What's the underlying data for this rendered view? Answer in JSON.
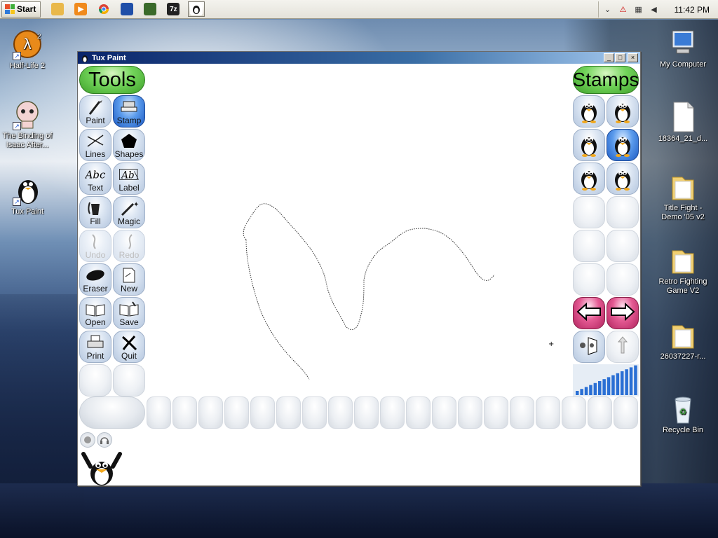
{
  "taskbar": {
    "start_label": "Start",
    "quick_launch": [
      {
        "icon": "folder-icon",
        "color": "#e9b84a",
        "glyph": ""
      },
      {
        "icon": "media-player-icon",
        "color": "#f08a1c",
        "glyph": "▶"
      },
      {
        "icon": "chrome-icon",
        "color": "#3d8ee8",
        "glyph": ""
      },
      {
        "icon": "app-blue-icon",
        "color": "#1f4fa8",
        "glyph": ""
      },
      {
        "icon": "globe-icon",
        "color": "#3a6a2a",
        "glyph": ""
      },
      {
        "icon": "7zip-icon",
        "color": "#222222",
        "glyph": "7z"
      },
      {
        "icon": "tux-paint-taskbar-icon",
        "color": "#ffffff",
        "glyph": ""
      }
    ],
    "clock": "11:42 PM"
  },
  "desktop": {
    "icons_left": [
      {
        "label": "Half-Life 2",
        "icon": "half-life-2-icon"
      },
      {
        "label": "The Binding of Isaac After...",
        "icon": "binding-of-isaac-icon"
      },
      {
        "label": "Tux Paint",
        "icon": "tux-paint-icon"
      }
    ],
    "icons_right": [
      {
        "label": "My Computer",
        "icon": "my-computer-icon"
      },
      {
        "label": "18364_21_d...",
        "icon": "file-icon"
      },
      {
        "label": "Title Fight - Demo '05 v2",
        "icon": "folder-icon"
      },
      {
        "label": "Retro Fighting Game V2",
        "icon": "folder-icon"
      },
      {
        "label": "26037227-r...",
        "icon": "folder-icon"
      },
      {
        "label": "Recycle Bin",
        "icon": "recycle-bin-icon"
      }
    ]
  },
  "window": {
    "title": "Tux Paint",
    "controls": {
      "minimize": "_",
      "maximize": "□",
      "close": "×"
    }
  },
  "tools": {
    "header": "Tools",
    "items": [
      {
        "label": "Paint",
        "icon": "paintbrush-icon",
        "state": "normal"
      },
      {
        "label": "Stamp",
        "icon": "stamp-icon",
        "state": "selected"
      },
      {
        "label": "Lines",
        "icon": "lines-icon",
        "state": "normal"
      },
      {
        "label": "Shapes",
        "icon": "pentagon-icon",
        "state": "normal"
      },
      {
        "label": "Text",
        "icon": "text-abc-icon",
        "state": "normal"
      },
      {
        "label": "Label",
        "icon": "label-abc-icon",
        "state": "normal"
      },
      {
        "label": "Fill",
        "icon": "paint-bucket-icon",
        "state": "normal"
      },
      {
        "label": "Magic",
        "icon": "magic-wand-icon",
        "state": "normal"
      },
      {
        "label": "Undo",
        "icon": "undo-icon",
        "state": "disabled"
      },
      {
        "label": "Redo",
        "icon": "redo-icon",
        "state": "disabled"
      },
      {
        "label": "Eraser",
        "icon": "eraser-icon",
        "state": "normal"
      },
      {
        "label": "New",
        "icon": "new-document-icon",
        "state": "normal"
      },
      {
        "label": "Open",
        "icon": "open-book-icon",
        "state": "normal"
      },
      {
        "label": "Save",
        "icon": "save-book-icon",
        "state": "normal"
      },
      {
        "label": "Print",
        "icon": "printer-icon",
        "state": "normal"
      },
      {
        "label": "Quit",
        "icon": "quit-x-icon",
        "state": "normal"
      }
    ]
  },
  "stamps": {
    "header": "Stamps",
    "items": [
      {
        "icon": "tux-stamp-icon",
        "state": "normal"
      },
      {
        "icon": "tux-stamp-icon",
        "state": "normal"
      },
      {
        "icon": "tux-stamp-icon",
        "state": "normal"
      },
      {
        "icon": "tux-stamp-icon",
        "state": "selected"
      },
      {
        "icon": "tux-stamp-icon",
        "state": "normal"
      },
      {
        "icon": "tux-stamp-icon",
        "state": "normal"
      }
    ],
    "nav": {
      "prev": "left-arrow-icon",
      "next": "right-arrow-icon"
    },
    "controls": {
      "mirror": "mirror-icon",
      "flip": "flip-icon"
    }
  },
  "status": {
    "helper": "tux-helper-icon"
  }
}
